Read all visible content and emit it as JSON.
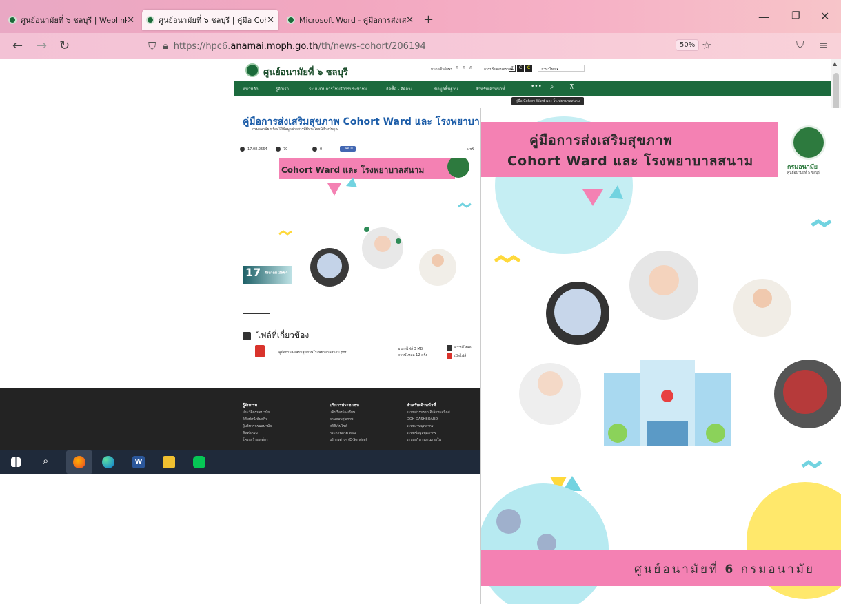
{
  "browser": {
    "tabs": [
      {
        "label": "ศูนย์อนามัยที่ ๖ ชลบุรี | Weblink",
        "active": false
      },
      {
        "label": "ศูนย์อนามัยที่ ๖ ชลบุรี | คู่มือ Coho",
        "active": true
      },
      {
        "label": "Microsoft Word - คู่มือการส่งเสริ",
        "active": false
      }
    ],
    "new_tab": "+",
    "url_scheme": "https://hpc6.",
    "url_domain": "anamai.moph.go.th",
    "url_path": "/th/news-cohort/206194",
    "zoom": "50%"
  },
  "site": {
    "title": "ศูนย์อนามัยที่ ๖ ชลบุรี",
    "font_size_label": "ขนาดตัวอักษร",
    "contrast_label": "การปรับคอนทราสต์",
    "language_label": "ภาษาไทย",
    "menu": [
      "หน้าหลัก",
      "รู้จักเรา",
      "ระบบงานการใช้บริการประชาชน",
      "จัดซื้อ - จัดจ้าง",
      "ข้อมูลพื้นฐาน",
      "สำหรับเจ้าหน้าที่"
    ],
    "tooltip": "คู่มือ Cohort Ward และ โรงพยาบาลสนาม",
    "article_title": "คู่มือการส่งเสริมสุขภาพ Cohort Ward และ โรงพยาบาลสนาม",
    "article_sub": "กรมอนามัย พร้อมให้ข้อมูลข่าวสารที่มีประโยชน์สำหรับคุณ",
    "meta_date": "17.08.2564",
    "meta_views": "70",
    "meta_comments": "0",
    "like_label": "Like 0",
    "share_label": "แชร์",
    "date_badge_day": "17",
    "date_badge_month": "สิงหาคม 2564",
    "files_heading": "ไฟล์ที่เกี่ยวข้อง",
    "file_name": "คู่มือการส่งเสริมสุขภาพโรงพยาบาลสนาม.pdf",
    "file_size": "ขนาดไฟล์ 3 MB",
    "file_downloads": "ดาวน์โหลด 12 ครั้ง",
    "download_label": "ดาวน์โหลด",
    "view_label": "เปิดไฟล์",
    "small_poster_title": "Cohort Ward และ โรงพยาบาลสนาม",
    "footer": [
      {
        "head": "รู้จักกรม",
        "items": [
          "ประวัติกรมอนามัย",
          "วิสัยทัศน์ พันธกิจ",
          "ผู้บริหารกรมอนามัย",
          "ติดต่อกรม",
          "โครงสร้างองค์กร"
        ]
      },
      {
        "head": "บริการประชาชน",
        "items": [
          "แจ้งเรื่องร้องเรียน",
          "ถามตอบสุขภาพ",
          "สถิติเว็บไซต์",
          "กระดานถาม-ตอบ",
          "บริการต่างๆ (E-Service)"
        ]
      },
      {
        "head": "สำหรับเจ้าหน้าที่",
        "items": [
          "ระบบสารบรรณอิเล็กทรอนิกส์",
          "DOH DASHBOARD",
          "ระบบงานบุคลากร",
          "ระบบข้อมูลบุคลากร",
          "ระบบบริหารงานภายใน"
        ]
      }
    ]
  },
  "poster": {
    "title_line1": "คู่มือการส่งเสริมสุขภาพ",
    "title_line2": "Cohort Ward และ โรงพยาบาลสนาม",
    "logo_text": "กรมอนามัย",
    "logo_sub": "ศูนย์อนามัยที่ ๖ ชลบุรี",
    "footer_text_a": "ศูนย์อนามัยที่",
    "footer_text_num": "6",
    "footer_text_b": "กรมอนามัย"
  },
  "colors": {
    "green": "#1c6a3d",
    "pink": "#f481b3",
    "teal": "#72d3e0",
    "yellow": "#ffe86b"
  },
  "icons": [
    "back-icon",
    "forward-icon",
    "reload-icon",
    "shield-icon",
    "lock-icon",
    "star-icon",
    "pocket-icon",
    "menu-icon",
    "search-icon",
    "sitemap-icon",
    "windows-icon",
    "firefox-icon",
    "edge-icon",
    "word-icon",
    "explorer-icon",
    "line-icon"
  ]
}
